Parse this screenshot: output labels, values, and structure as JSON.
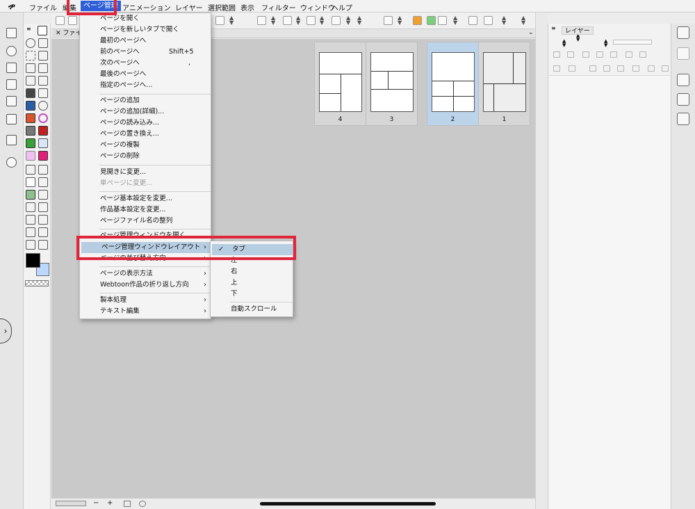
{
  "menubar": {
    "logo": "ዏ",
    "items": [
      "ファイル",
      "編集",
      "ページ管理",
      "アニメーション",
      "レイヤー",
      "選択範囲",
      "表示",
      "フィルター",
      "ウィンドウ",
      "ヘルプ"
    ],
    "active": "ページ管理"
  },
  "canvas": {
    "tab_close": "✕",
    "tab_label": "ファイル"
  },
  "page_menu": {
    "items": [
      {
        "label": "ページを開く",
        "shortcut": "",
        "submenu": false,
        "disabled": false
      },
      {
        "label": "ページを新しいタブで開く",
        "shortcut": "",
        "submenu": false,
        "disabled": false
      },
      {
        "label": "最初のページへ",
        "shortcut": "",
        "submenu": false,
        "disabled": false
      },
      {
        "label": "前のページへ",
        "shortcut": "Shift+5",
        "submenu": false,
        "disabled": false
      },
      {
        "label": "次のページへ",
        "shortcut": ",",
        "submenu": false,
        "disabled": false
      },
      {
        "label": "最後のページへ",
        "shortcut": "",
        "submenu": false,
        "disabled": false
      },
      {
        "label": "指定のページへ...",
        "shortcut": "",
        "submenu": false,
        "disabled": false
      },
      {
        "label": "ページの追加",
        "shortcut": "",
        "submenu": false,
        "disabled": false
      },
      {
        "label": "ページの追加(詳細)...",
        "shortcut": "",
        "submenu": false,
        "disabled": false
      },
      {
        "label": "ページの読み込み...",
        "shortcut": "",
        "submenu": false,
        "disabled": false
      },
      {
        "label": "ページの置き換え...",
        "shortcut": "",
        "submenu": false,
        "disabled": false
      },
      {
        "label": "ページの複製",
        "shortcut": "",
        "submenu": false,
        "disabled": false
      },
      {
        "label": "ページの削除",
        "shortcut": "",
        "submenu": false,
        "disabled": false
      },
      {
        "label": "見開きに変更...",
        "shortcut": "",
        "submenu": false,
        "disabled": false
      },
      {
        "label": "単ページに変更...",
        "shortcut": "",
        "submenu": false,
        "disabled": true
      },
      {
        "label": "ページ基本設定を変更...",
        "shortcut": "",
        "submenu": false,
        "disabled": false
      },
      {
        "label": "作品基本設定を変更...",
        "shortcut": "",
        "submenu": false,
        "disabled": false
      },
      {
        "label": "ページファイル名の整列",
        "shortcut": "",
        "submenu": false,
        "disabled": false
      },
      {
        "label": "ページ管理ウィンドウを開く",
        "shortcut": "",
        "submenu": false,
        "disabled": false
      },
      {
        "label": "ページ管理ウィンドウレイアウト",
        "shortcut": "",
        "submenu": true,
        "disabled": false
      },
      {
        "label": "ページの並び替え方向",
        "shortcut": "",
        "submenu": true,
        "disabled": false
      },
      {
        "label": "ページの表示方法",
        "shortcut": "",
        "submenu": true,
        "disabled": false
      },
      {
        "label": "Webtoon作品の折り返し方向",
        "shortcut": "",
        "submenu": true,
        "disabled": false
      },
      {
        "label": "製本処理",
        "shortcut": "",
        "submenu": true,
        "disabled": false
      },
      {
        "label": "テキスト編集",
        "shortcut": "",
        "submenu": true,
        "disabled": false
      }
    ],
    "highlighted": "ページ管理ウィンドウレイアウト",
    "submenu_arrow": "›"
  },
  "layout_submenu": {
    "items": [
      {
        "label": "タブ",
        "checked": true
      },
      {
        "label": "左",
        "checked": false
      },
      {
        "label": "右",
        "checked": false
      },
      {
        "label": "上",
        "checked": false
      },
      {
        "label": "下",
        "checked": false
      },
      {
        "label": "自動スクロール",
        "checked": false
      }
    ],
    "check_mark": "✓"
  },
  "pages": [
    {
      "number": "4",
      "selected": false
    },
    {
      "number": "3",
      "selected": false
    },
    {
      "number": "2",
      "selected": true
    },
    {
      "number": "1",
      "selected": false
    }
  ],
  "layer_panel": {
    "tab_label": "レイヤー",
    "menu_icon": "≡"
  },
  "statusbar": {
    "zoom_out": "−",
    "zoom_in": "+"
  },
  "colors": {
    "menu_highlight": "#b6cde2",
    "annotation": "#e0243a",
    "selected_page": "#bcd4ea",
    "main_color": "#000000",
    "sub_color": "#bcd8ff"
  }
}
